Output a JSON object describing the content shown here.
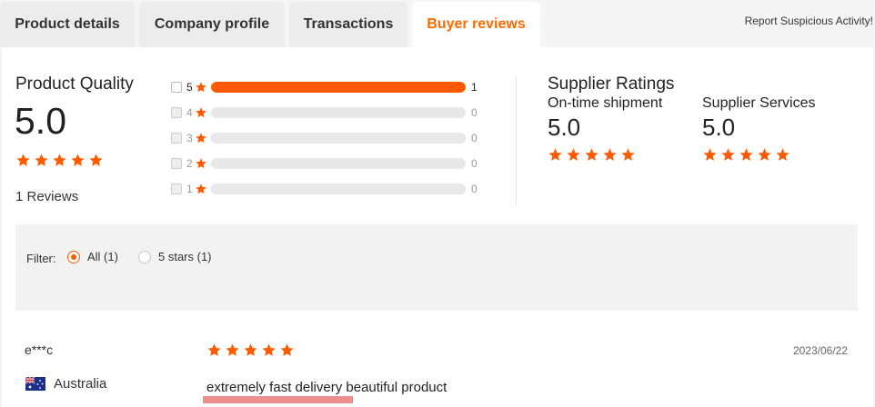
{
  "colors": {
    "accent": "#ff5a00",
    "star": "#ff5a00"
  },
  "tabs": [
    {
      "label": "Product details",
      "active": false
    },
    {
      "label": "Company profile",
      "active": false
    },
    {
      "label": "Transactions",
      "active": false
    },
    {
      "label": "Buyer reviews",
      "active": true
    }
  ],
  "report_link": "Report Suspicious Activity!",
  "product_quality": {
    "title": "Product Quality",
    "score": "5.0",
    "stars": 5,
    "reviews": "1 Reviews"
  },
  "rating_bars": [
    {
      "stars": "5",
      "count": "1",
      "fraction": 1.0,
      "enabled": true
    },
    {
      "stars": "4",
      "count": "0",
      "fraction": 0,
      "enabled": false
    },
    {
      "stars": "3",
      "count": "0",
      "fraction": 0,
      "enabled": false
    },
    {
      "stars": "2",
      "count": "0",
      "fraction": 0,
      "enabled": false
    },
    {
      "stars": "1",
      "count": "0",
      "fraction": 0,
      "enabled": false
    }
  ],
  "supplier_ratings": {
    "title": "Supplier Ratings",
    "shipment": {
      "label": "On-time shipment",
      "score": "5.0",
      "stars": 5
    },
    "services": {
      "label": "Supplier Services",
      "score": "5.0",
      "stars": 5
    }
  },
  "filter": {
    "label": "Filter:",
    "options": [
      {
        "label": "All (1)",
        "selected": true
      },
      {
        "label": "5 stars (1)",
        "selected": false
      }
    ]
  },
  "review": {
    "reviewer": "e***c",
    "country": "Australia",
    "flag_icon": "australia-flag-icon",
    "stars": 5,
    "date": "2023/06/22",
    "text": "extremely fast delivery beautiful product"
  }
}
